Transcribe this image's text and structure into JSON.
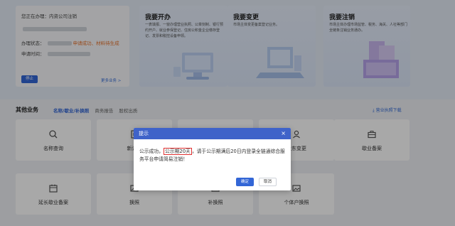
{
  "status": {
    "processing_label": "您正在办理：内资公司注销",
    "state_label": "办理状态：",
    "state_value": "申请成功、材料待生成",
    "time_label": "申请时间：",
    "button": "停止",
    "more_link": "更多业务 >"
  },
  "features": [
    {
      "title": "我要开办",
      "desc": "一表填报、一窗办理营业执照、公章刻制、银行预约开户、就业参保登记、住房公积金企业缴存登记、发票和税控设备申领。"
    },
    {
      "title": "我要变更",
      "desc": "市场主体变更备案登记业务。"
    },
    {
      "title": "我要注销",
      "desc": "市场主体办理市场监管、税务、海关、人社等部门全链条注销业务通办。"
    }
  ],
  "other_business": {
    "title": "其他业务",
    "tabs": [
      "名称/歇业/补换照",
      "商务报告",
      "股权出质"
    ],
    "download": "营业执照下载",
    "cards_row1": [
      {
        "label": "名称查询",
        "icon": "search-icon"
      },
      {
        "label": "新设名",
        "icon": "document-icon"
      },
      {
        "label": "",
        "icon": "empty-icon"
      },
      {
        "label": "股东变更",
        "icon": "user-icon"
      },
      {
        "label": "歇业备案",
        "icon": "briefcase-icon"
      }
    ],
    "cards_row2": [
      {
        "label": "延长歇业备案",
        "icon": "calendar-icon"
      },
      {
        "label": "换照",
        "icon": "image-icon"
      },
      {
        "label": "补换照",
        "icon": "image-icon"
      },
      {
        "label": "个体户换照",
        "icon": "image-icon"
      }
    ]
  },
  "dialog": {
    "title": "提示",
    "msg_prefix": "公示成功，",
    "msg_highlight": "公示期20天",
    "msg_suffix": "，请于公示期满后20日内登录全链通综合服务平台申请简易注销！",
    "confirm": "确定",
    "cancel": "取消"
  },
  "colors": {
    "accent": "#3366d6",
    "dialog_header": "#3f63c9",
    "highlight_border": "#e03030",
    "status_orange": "#e6702a"
  }
}
